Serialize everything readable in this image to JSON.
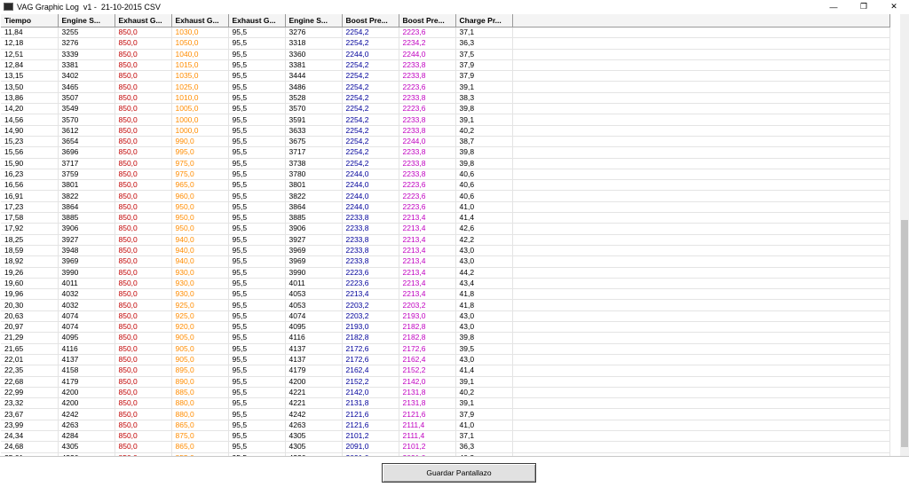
{
  "window": {
    "title": "VAG Graphic Log  v1 -  21-10-2015 CSV",
    "minimize_glyph": "—",
    "maximize_glyph": "❐",
    "close_glyph": "✕"
  },
  "table": {
    "columns": [
      "Tiempo",
      "Engine S...",
      "Exhaust G...",
      "Exhaust G...",
      "Exhaust G...",
      "Engine S...",
      "Boost Pre...",
      "Boost Pre...",
      "Charge Pr..."
    ],
    "column_colors": {
      "exhaust_1": "#c00000",
      "exhaust_2": "#ff8c00",
      "boost_1": "#00009a",
      "boost_2": "#c000c0",
      "default": "#000000"
    },
    "rows": [
      [
        "11,84",
        "3255",
        "850,0",
        "1030,0",
        "95,5",
        "3276",
        "2254,2",
        "2223,6",
        "37,1"
      ],
      [
        "12,18",
        "3276",
        "850,0",
        "1050,0",
        "95,5",
        "3318",
        "2254,2",
        "2234,2",
        "36,3"
      ],
      [
        "12,51",
        "3339",
        "850,0",
        "1040,0",
        "95,5",
        "3360",
        "2244,0",
        "2244,0",
        "37,5"
      ],
      [
        "12,84",
        "3381",
        "850,0",
        "1015,0",
        "95,5",
        "3381",
        "2254,2",
        "2233,8",
        "37,9"
      ],
      [
        "13,15",
        "3402",
        "850,0",
        "1035,0",
        "95,5",
        "3444",
        "2254,2",
        "2233,8",
        "37,9"
      ],
      [
        "13,50",
        "3465",
        "850,0",
        "1025,0",
        "95,5",
        "3486",
        "2254,2",
        "2223,6",
        "39,1"
      ],
      [
        "13,86",
        "3507",
        "850,0",
        "1010,0",
        "95,5",
        "3528",
        "2254,2",
        "2233,8",
        "38,3"
      ],
      [
        "14,20",
        "3549",
        "850,0",
        "1005,0",
        "95,5",
        "3570",
        "2254,2",
        "2223,6",
        "39,8"
      ],
      [
        "14,56",
        "3570",
        "850,0",
        "1000,0",
        "95,5",
        "3591",
        "2254,2",
        "2233,8",
        "39,1"
      ],
      [
        "14,90",
        "3612",
        "850,0",
        "1000,0",
        "95,5",
        "3633",
        "2254,2",
        "2233,8",
        "40,2"
      ],
      [
        "15,23",
        "3654",
        "850,0",
        "990,0",
        "95,5",
        "3675",
        "2254,2",
        "2244,0",
        "38,7"
      ],
      [
        "15,56",
        "3696",
        "850,0",
        "995,0",
        "95,5",
        "3717",
        "2254,2",
        "2233,8",
        "39,8"
      ],
      [
        "15,90",
        "3717",
        "850,0",
        "975,0",
        "95,5",
        "3738",
        "2254,2",
        "2233,8",
        "39,8"
      ],
      [
        "16,23",
        "3759",
        "850,0",
        "975,0",
        "95,5",
        "3780",
        "2244,0",
        "2233,8",
        "40,6"
      ],
      [
        "16,56",
        "3801",
        "850,0",
        "965,0",
        "95,5",
        "3801",
        "2244,0",
        "2223,6",
        "40,6"
      ],
      [
        "16,91",
        "3822",
        "850,0",
        "960,0",
        "95,5",
        "3822",
        "2244,0",
        "2223,6",
        "40,6"
      ],
      [
        "17,23",
        "3864",
        "850,0",
        "950,0",
        "95,5",
        "3864",
        "2244,0",
        "2223,6",
        "41,0"
      ],
      [
        "17,58",
        "3885",
        "850,0",
        "950,0",
        "95,5",
        "3885",
        "2233,8",
        "2213,4",
        "41,4"
      ],
      [
        "17,92",
        "3906",
        "850,0",
        "950,0",
        "95,5",
        "3906",
        "2233,8",
        "2213,4",
        "42,6"
      ],
      [
        "18,25",
        "3927",
        "850,0",
        "940,0",
        "95,5",
        "3927",
        "2233,8",
        "2213,4",
        "42,2"
      ],
      [
        "18,59",
        "3948",
        "850,0",
        "940,0",
        "95,5",
        "3969",
        "2233,8",
        "2213,4",
        "43,0"
      ],
      [
        "18,92",
        "3969",
        "850,0",
        "940,0",
        "95,5",
        "3969",
        "2233,8",
        "2213,4",
        "43,0"
      ],
      [
        "19,26",
        "3990",
        "850,0",
        "930,0",
        "95,5",
        "3990",
        "2223,6",
        "2213,4",
        "44,2"
      ],
      [
        "19,60",
        "4011",
        "850,0",
        "930,0",
        "95,5",
        "4011",
        "2223,6",
        "2213,4",
        "43,4"
      ],
      [
        "19,96",
        "4032",
        "850,0",
        "930,0",
        "95,5",
        "4053",
        "2213,4",
        "2213,4",
        "41,8"
      ],
      [
        "20,30",
        "4032",
        "850,0",
        "925,0",
        "95,5",
        "4053",
        "2203,2",
        "2203,2",
        "41,8"
      ],
      [
        "20,63",
        "4074",
        "850,0",
        "925,0",
        "95,5",
        "4074",
        "2203,2",
        "2193,0",
        "43,0"
      ],
      [
        "20,97",
        "4074",
        "850,0",
        "920,0",
        "95,5",
        "4095",
        "2193,0",
        "2182,8",
        "43,0"
      ],
      [
        "21,29",
        "4095",
        "850,0",
        "905,0",
        "95,5",
        "4116",
        "2182,8",
        "2182,8",
        "39,8"
      ],
      [
        "21,65",
        "4116",
        "850,0",
        "905,0",
        "95,5",
        "4137",
        "2172,6",
        "2172,6",
        "39,5"
      ],
      [
        "22,01",
        "4137",
        "850,0",
        "905,0",
        "95,5",
        "4137",
        "2172,6",
        "2162,4",
        "43,0"
      ],
      [
        "22,35",
        "4158",
        "850,0",
        "895,0",
        "95,5",
        "4179",
        "2162,4",
        "2152,2",
        "41,4"
      ],
      [
        "22,68",
        "4179",
        "850,0",
        "890,0",
        "95,5",
        "4200",
        "2152,2",
        "2142,0",
        "39,1"
      ],
      [
        "22,99",
        "4200",
        "850,0",
        "885,0",
        "95,5",
        "4221",
        "2142,0",
        "2131,8",
        "40,2"
      ],
      [
        "23,32",
        "4200",
        "850,0",
        "880,0",
        "95,5",
        "4221",
        "2131,8",
        "2131,8",
        "39,1"
      ],
      [
        "23,67",
        "4242",
        "850,0",
        "880,0",
        "95,5",
        "4242",
        "2121,6",
        "2121,6",
        "37,9"
      ],
      [
        "23,99",
        "4263",
        "850,0",
        "865,0",
        "95,5",
        "4263",
        "2121,6",
        "2111,4",
        "41,0"
      ],
      [
        "24,34",
        "4284",
        "850,0",
        "875,0",
        "95,5",
        "4305",
        "2101,2",
        "2111,4",
        "37,1"
      ],
      [
        "24,68",
        "4305",
        "850,0",
        "865,0",
        "95,5",
        "4305",
        "2091,0",
        "2101,2",
        "36,3"
      ],
      [
        "25,01",
        "4326",
        "850,0",
        "855,0",
        "95,5",
        "4326",
        "2091,0",
        "2091,0",
        "40,2"
      ],
      [
        "25,34",
        "4326",
        "850,0",
        "855,0",
        "95,5",
        "4347",
        "2070,6",
        "2091,0",
        "35,1"
      ],
      [
        "25,68",
        "4368",
        "850,0",
        "850,0",
        "95,5",
        "4368",
        "2060,4",
        "2080,8",
        "35,1"
      ]
    ]
  },
  "footer": {
    "save_button_label": "Guardar Pantallazo"
  }
}
